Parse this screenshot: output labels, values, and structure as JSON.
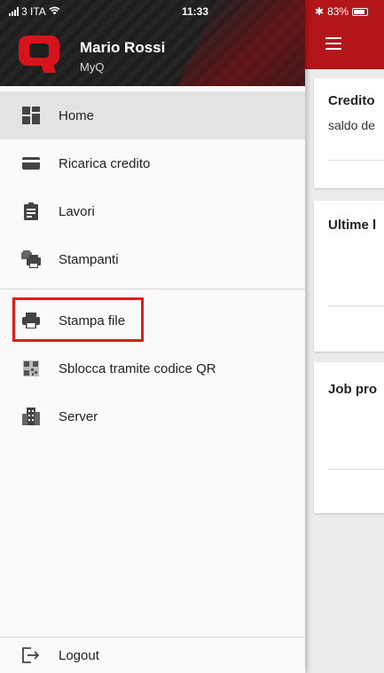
{
  "status_bar": {
    "carrier": "3 ITA",
    "time": "11:33",
    "battery": "83%"
  },
  "drawer": {
    "user_name": "Mario Rossi",
    "user_subtitle": "MyQ",
    "menu_items": [
      {
        "label": "Home",
        "icon": "home-grid-icon",
        "active": true
      },
      {
        "label": "Ricarica credito",
        "icon": "credit-card-icon"
      },
      {
        "label": "Lavori",
        "icon": "clipboard-icon"
      },
      {
        "label": "Stampanti",
        "icon": "printers-icon"
      },
      {
        "label": "Stampa file",
        "icon": "printer-icon",
        "highlighted": true
      },
      {
        "label": "Sblocca tramite codice QR",
        "icon": "qr-code-icon"
      },
      {
        "label": "Server",
        "icon": "building-icon"
      }
    ],
    "logout_label": "Logout"
  },
  "main": {
    "cards": [
      {
        "title": "Credito",
        "subtitle": "saldo de"
      },
      {
        "title": "Ultime l"
      },
      {
        "title": "Job pro"
      }
    ]
  },
  "colors": {
    "brand_red": "#b3151a",
    "highlight_red": "#e01e1e",
    "header_dark": "#1e1e1e"
  }
}
